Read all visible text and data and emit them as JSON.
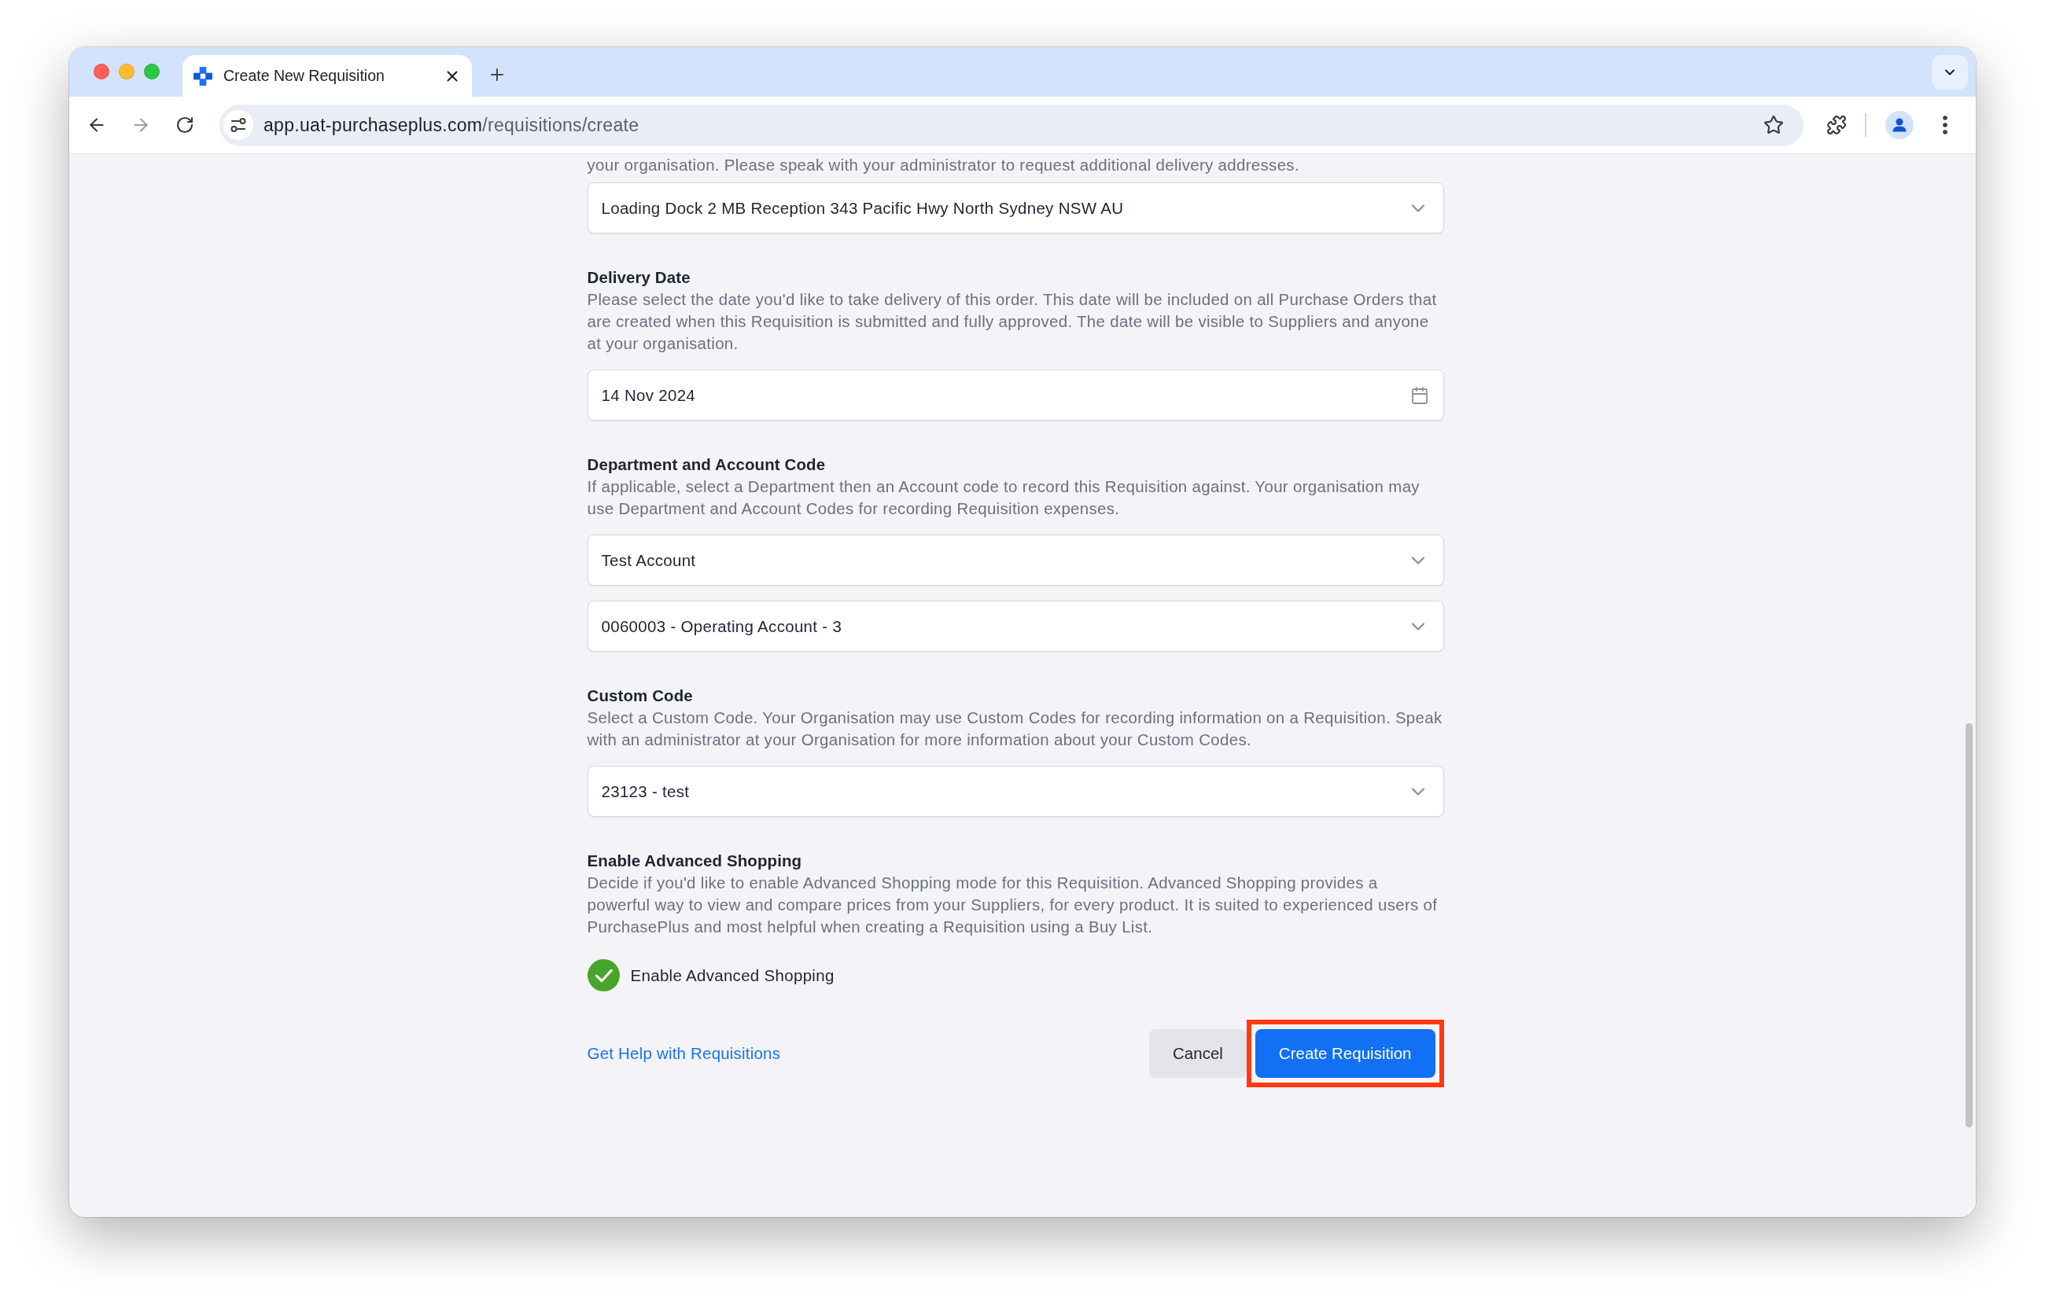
{
  "browser": {
    "tabs": [
      {
        "title": "Create New Requisition",
        "selected": true
      }
    ],
    "url_host": "app.uat-purchaseplus.com",
    "url_path": "/requisitions/create"
  },
  "form": {
    "sections": [
      {
        "description": "your organisation. Please speak with your administrator to request additional delivery addresses.",
        "fields": [
          {
            "kind": "select",
            "value": "Loading Dock 2 MB Reception 343 Pacific Hwy North Sydney NSW AU"
          }
        ]
      },
      {
        "label": "Delivery Date",
        "description": "Please select the date you'd like to take delivery of this order. This date will be included on all Purchase Orders that are created when this Requisition is submitted and fully approved. The date will be visible to Suppliers and anyone at your organisation.",
        "fields": [
          {
            "kind": "date",
            "value": "14 Nov 2024"
          }
        ]
      },
      {
        "label": "Department and Account Code",
        "description": "If applicable, select a Department then an Account code to record this Requisition against. Your organisation may use Department and Account Codes for recording Requisition expenses.",
        "fields": [
          {
            "kind": "select",
            "value": "Test Account"
          },
          {
            "kind": "select",
            "value": "0060003 - Operating Account - 3"
          }
        ]
      },
      {
        "label": "Custom Code",
        "description": "Select a Custom Code. Your Organisation may use Custom Codes for recording information on a Requisition. Speak with an administrator at your Organisation for more information about your Custom Codes.",
        "fields": [
          {
            "kind": "select",
            "value": "23123 - test"
          }
        ]
      },
      {
        "label": "Enable Advanced Shopping",
        "description": "Decide if you'd like to enable Advanced Shopping mode for this Requisition. Advanced Shopping provides a powerful way to view and compare prices from your Suppliers, for every product. It is suited to experienced users of PurchasePlus and most helpful when creating a Requisition using a Buy List.",
        "fields": [
          {
            "kind": "checkbox",
            "label": "Enable Advanced Shopping",
            "checked": true
          }
        ]
      }
    ]
  },
  "footer": {
    "help_link": "Get Help with Requisitions",
    "buttons": [
      {
        "label": "Cancel",
        "kind": "secondary",
        "highlighted": false
      },
      {
        "label": "Create Requisition",
        "kind": "primary",
        "highlighted": true
      }
    ]
  }
}
